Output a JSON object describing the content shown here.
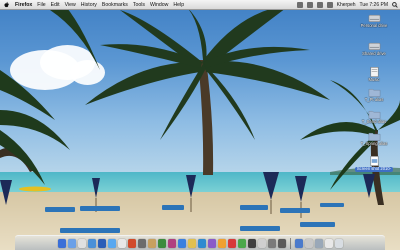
{
  "menubar": {
    "app_name": "Firefox",
    "items": [
      "File",
      "Edit",
      "View",
      "History",
      "Bookmarks",
      "Tools",
      "Window",
      "Help"
    ],
    "user": "Kherpeh",
    "clock": "Tue 7:26 PM"
  },
  "desktop_icons": [
    {
      "label": "Personal drive",
      "name": "desktop-icon-personal-drive"
    },
    {
      "label": "Shared drive",
      "name": "desktop-icon-shared-drive"
    },
    {
      "label": "Music",
      "name": "desktop-icon-music"
    },
    {
      "label": "T_Pt alias",
      "name": "desktop-icon-pt-alias"
    },
    {
      "label": "T_Send alias",
      "name": "desktop-icon-send-alias"
    },
    {
      "label": "T_Spring alias",
      "name": "desktop-icon-spring-alias"
    },
    {
      "label": "Screen shot 2010-",
      "name": "desktop-icon-screenshot"
    }
  ],
  "dock": {
    "app_colors": [
      "#3a6fd8",
      "#6aa0e8",
      "#e0e0e0",
      "#4a90d8",
      "#2a5db8",
      "#58a8f0",
      "#e8e8e8",
      "#d14a2a",
      "#6c6c6c",
      "#c8a060",
      "#3d8b3d",
      "#b04080",
      "#3a7fe0",
      "#e0c050",
      "#2f8ad0",
      "#8a5ac8",
      "#f0a030",
      "#d83a3a",
      "#4aa84a",
      "#404040",
      "#cfcfcf",
      "#7a7a7a",
      "#5a5a5a"
    ],
    "right_colors": [
      "#4a7acc",
      "#c8c8c8",
      "#9aa8b8",
      "#e8e8e8"
    ]
  },
  "colors": {
    "menubar": "#e6e6e6",
    "selection": "#3e6fc5"
  }
}
